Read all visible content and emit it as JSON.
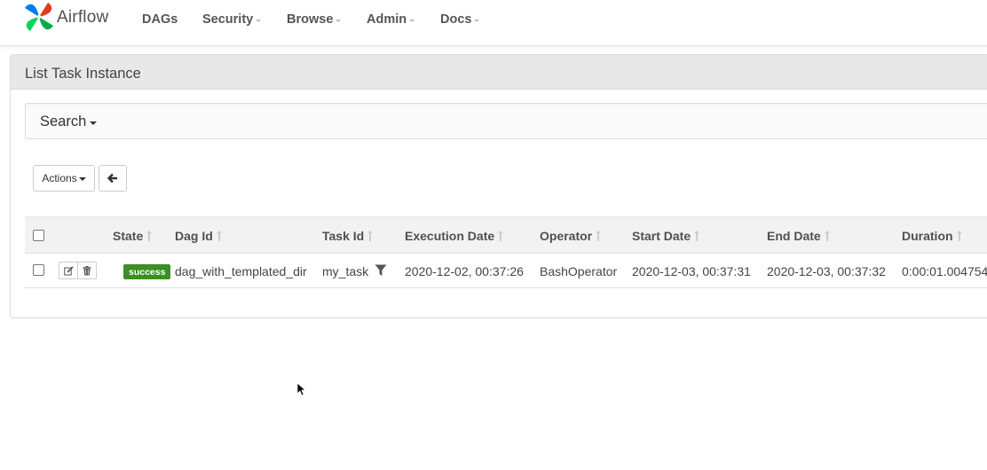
{
  "brand": {
    "name": "Airflow"
  },
  "nav": [
    {
      "label": "DAGs",
      "dropdown": false
    },
    {
      "label": "Security",
      "dropdown": true
    },
    {
      "label": "Browse",
      "dropdown": true
    },
    {
      "label": "Admin",
      "dropdown": true
    },
    {
      "label": "Docs",
      "dropdown": true
    }
  ],
  "panel": {
    "title": "List Task Instance"
  },
  "search": {
    "label": "Search"
  },
  "toolbar": {
    "actions_label": "Actions",
    "back_icon": "arrow-left-icon"
  },
  "table": {
    "columns": [
      "State",
      "Dag Id",
      "Task Id",
      "Execution Date",
      "Operator",
      "Start Date",
      "End Date",
      "Duration"
    ],
    "rows": [
      {
        "state": "success",
        "dag_id": "dag_with_templated_dir",
        "task_id": "my_task",
        "execution_date": "2020-12-02, 00:37:26",
        "operator": "BashOperator",
        "start_date": "2020-12-03, 00:37:31",
        "end_date": "2020-12-03, 00:37:32",
        "duration": "0:00:01.004754"
      }
    ]
  },
  "colors": {
    "success": "#3b8f23",
    "header_bg": "#e8e8e8"
  }
}
